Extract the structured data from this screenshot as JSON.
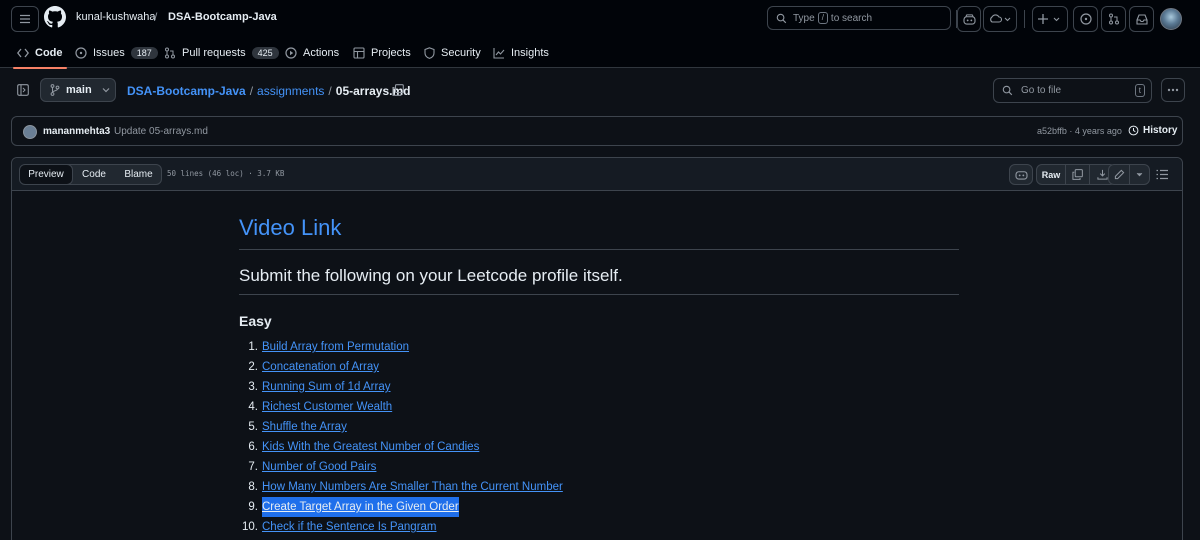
{
  "header": {
    "owner": "kunal-kushwaha",
    "separator": "/",
    "repo": "DSA-Bootcamp-Java",
    "search_label": "Type",
    "search_key": "/",
    "search_suffix": "to search"
  },
  "tabs": [
    {
      "label": "Code",
      "count": ""
    },
    {
      "label": "Issues",
      "count": "187"
    },
    {
      "label": "Pull requests",
      "count": "425"
    },
    {
      "label": "Actions",
      "count": ""
    },
    {
      "label": "Projects",
      "count": ""
    },
    {
      "label": "Security",
      "count": ""
    },
    {
      "label": "Insights",
      "count": ""
    }
  ],
  "filebar": {
    "branch": "main",
    "crumb_repo": "DSA-Bootcamp-Java",
    "crumb_sep": "/",
    "crumb_folder": "assignments",
    "crumb_file": "05-arrays.md",
    "goto_placeholder": "Go to file",
    "goto_key": "t"
  },
  "commit": {
    "user": "mananmehta3",
    "message": "Update 05-arrays.md",
    "hash_time": "a52bffb · 4 years ago",
    "history_label": "History"
  },
  "fileview": {
    "modes": [
      "Preview",
      "Code",
      "Blame"
    ],
    "active_mode": "Preview",
    "meta": "50 lines (46 loc) · 3.7 KB",
    "raw_label": "Raw"
  },
  "markdown": {
    "h1": "Video Link",
    "h2": "Submit the following on your Leetcode profile itself.",
    "h3": "Easy",
    "items": [
      {
        "n": "1.",
        "text": "Build Array from Permutation"
      },
      {
        "n": "2.",
        "text": "Concatenation of Array"
      },
      {
        "n": "3.",
        "text": "Running Sum of 1d Array"
      },
      {
        "n": "4.",
        "text": "Richest Customer Wealth"
      },
      {
        "n": "5.",
        "text": "Shuffle the Array"
      },
      {
        "n": "6.",
        "text": "Kids With the Greatest Number of Candies"
      },
      {
        "n": "7.",
        "text": "Number of Good Pairs"
      },
      {
        "n": "8.",
        "text": "How Many Numbers Are Smaller Than the Current Number"
      },
      {
        "n": "9.",
        "text": "Create Target Array in the Given Order"
      },
      {
        "n": "10.",
        "text": "Check if the Sentence Is Pangram"
      }
    ],
    "selected_item": 8
  },
  "colors": {
    "background": "#0d1117",
    "link": "#4493f8",
    "tab_underline": "#f78166",
    "selection": "#1f6feb"
  }
}
